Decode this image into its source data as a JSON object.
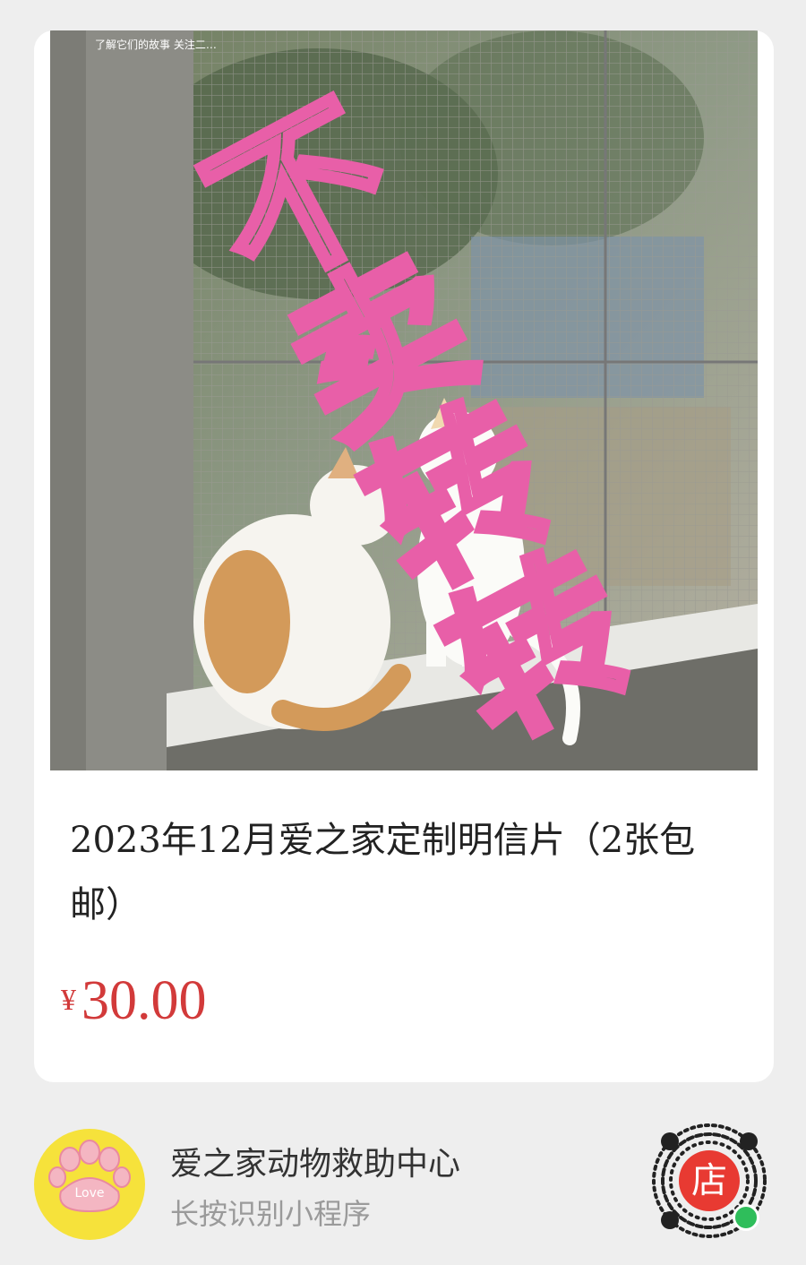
{
  "product": {
    "image_watermark": "不卖转转",
    "image_corner_text": "了解它们的故事 关注二…",
    "title": "2023年12月爱之家定制明信片（2张包邮）",
    "currency_symbol": "¥",
    "price": "30.00"
  },
  "shop": {
    "name": "爱之家动物救助中心",
    "subtitle": "长按识别小程序",
    "logo_text": "Love",
    "qr_center_label": "店"
  },
  "colors": {
    "price": "#d23a3a",
    "watermark": "#e85fa8",
    "avatar_bg": "#f6e23b",
    "qr_center": "#e83a32"
  }
}
